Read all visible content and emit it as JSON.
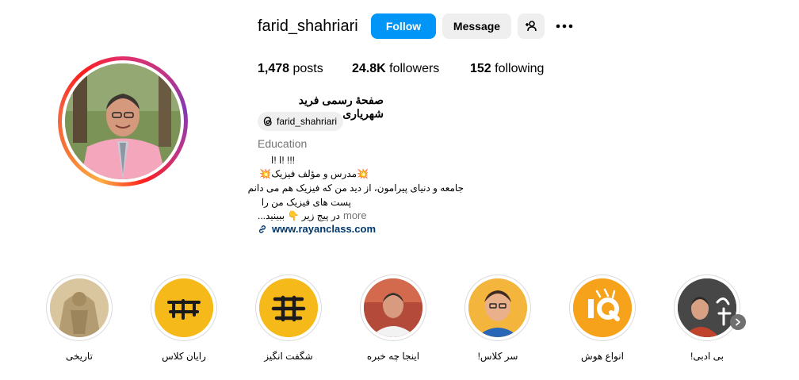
{
  "profile": {
    "username": "farid_shahriari",
    "follow_label": "Follow",
    "message_label": "Message",
    "posts_count": "1,478",
    "posts_label": "posts",
    "followers_count": "24.8K",
    "followers_label": "followers",
    "following_count": "152",
    "following_label": "following",
    "full_name": "صفحهٔ رسمی فرید شهریاری",
    "threads_handle": "farid_shahriari",
    "category": "Education",
    "bio_lines": [
      "!!! !ا !ا",
      "💥مدرس و مؤلف فیزیک💥",
      "جامعه و دنیای پیرامون، از دید من که فیزیک هم می دانم",
      "پست های فیزیک من را",
      "در پیج زیر 👇 ببینید..."
    ],
    "more_label": "more",
    "website": "www.rayanclass.com"
  },
  "highlights": [
    {
      "label": "تاریخی",
      "icon": "ancient-relief-image"
    },
    {
      "label": "رایان کلاس",
      "icon": "rayan-class-logo"
    },
    {
      "label": "شگفت انگیز",
      "icon": "amazing-logo"
    },
    {
      "label": "اینجا چه خبره",
      "icon": "person-photo"
    },
    {
      "label": "سر کلاس!",
      "icon": "cartoon-portrait"
    },
    {
      "label": "انواع هوش",
      "icon": "iq-logo"
    },
    {
      "label": "بی ادبی!",
      "icon": "person-photo-dark"
    }
  ],
  "colors": {
    "accent": "#0095f6",
    "secondary_button": "#efefef",
    "link": "#00376b",
    "muted_text": "#737373",
    "highlight_yellow": "#f6b91a",
    "highlight_orange": "#f7a21b"
  }
}
